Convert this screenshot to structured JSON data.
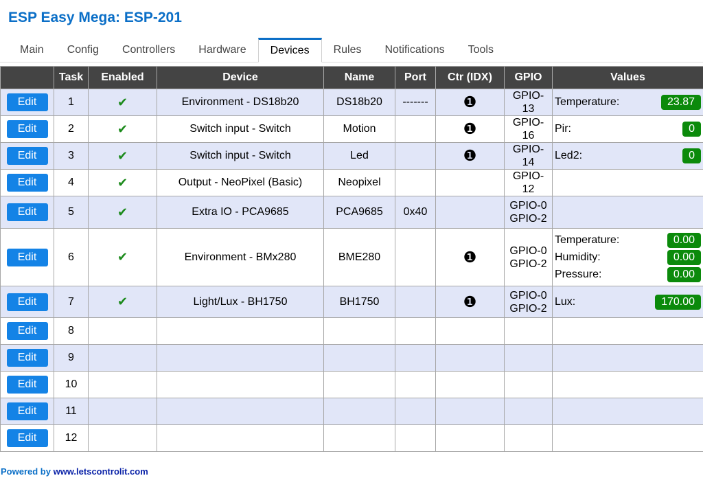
{
  "app": {
    "title": "ESP Easy Mega: ESP-201"
  },
  "tabs": [
    {
      "label": "Main"
    },
    {
      "label": "Config"
    },
    {
      "label": "Controllers"
    },
    {
      "label": "Hardware"
    },
    {
      "label": "Devices"
    },
    {
      "label": "Rules"
    },
    {
      "label": "Notifications"
    },
    {
      "label": "Tools"
    }
  ],
  "active_tab": "Devices",
  "table": {
    "headers": [
      "",
      "Task",
      "Enabled",
      "Device",
      "Name",
      "Port",
      "Ctr (IDX)",
      "GPIO",
      "Values"
    ],
    "edit_label": "Edit",
    "rows": [
      {
        "task": "1",
        "enabled": "✔",
        "device": "Environment - DS18b20",
        "name": "DS18b20",
        "port": "-------",
        "ctr": "❶",
        "gpio": [
          "GPIO-13"
        ],
        "values": [
          {
            "label": "Temperature:",
            "value": "23.87"
          }
        ]
      },
      {
        "task": "2",
        "enabled": "✔",
        "device": "Switch input - Switch",
        "name": "Motion",
        "port": "",
        "ctr": "❶",
        "gpio": [
          "GPIO-16"
        ],
        "values": [
          {
            "label": "Pir:",
            "value": "0"
          }
        ]
      },
      {
        "task": "3",
        "enabled": "✔",
        "device": "Switch input - Switch",
        "name": "Led",
        "port": "",
        "ctr": "❶",
        "gpio": [
          "GPIO-14"
        ],
        "values": [
          {
            "label": "Led2:",
            "value": "0"
          }
        ]
      },
      {
        "task": "4",
        "enabled": "✔",
        "device": "Output - NeoPixel (Basic)",
        "name": "Neopixel",
        "port": "",
        "ctr": "",
        "gpio": [
          "GPIO-12"
        ],
        "values": []
      },
      {
        "task": "5",
        "enabled": "✔",
        "device": "Extra IO - PCA9685",
        "name": "PCA9685",
        "port": "0x40",
        "ctr": "",
        "gpio": [
          "GPIO-0",
          "GPIO-2"
        ],
        "values": []
      },
      {
        "task": "6",
        "enabled": "✔",
        "device": "Environment - BMx280",
        "name": "BME280",
        "port": "",
        "ctr": "❶",
        "gpio": [
          "GPIO-0",
          "GPIO-2"
        ],
        "values": [
          {
            "label": "Temperature:",
            "value": "0.00"
          },
          {
            "label": "Humidity:",
            "value": "0.00"
          },
          {
            "label": "Pressure:",
            "value": "0.00"
          }
        ]
      },
      {
        "task": "7",
        "enabled": "✔",
        "device": "Light/Lux - BH1750",
        "name": "BH1750",
        "port": "",
        "ctr": "❶",
        "gpio": [
          "GPIO-0",
          "GPIO-2"
        ],
        "values": [
          {
            "label": "Lux:",
            "value": "170.00"
          }
        ]
      },
      {
        "task": "8",
        "enabled": "",
        "device": "",
        "name": "",
        "port": "",
        "ctr": "",
        "gpio": [],
        "values": []
      },
      {
        "task": "9",
        "enabled": "",
        "device": "",
        "name": "",
        "port": "",
        "ctr": "",
        "gpio": [],
        "values": []
      },
      {
        "task": "10",
        "enabled": "",
        "device": "",
        "name": "",
        "port": "",
        "ctr": "",
        "gpio": [],
        "values": []
      },
      {
        "task": "11",
        "enabled": "",
        "device": "",
        "name": "",
        "port": "",
        "ctr": "",
        "gpio": [],
        "values": []
      },
      {
        "task": "12",
        "enabled": "",
        "device": "",
        "name": "",
        "port": "",
        "ctr": "",
        "gpio": [],
        "values": []
      }
    ]
  },
  "footer": {
    "prefix": "Powered by ",
    "link": "www.letscontrolit.com"
  },
  "colors": {
    "accent": "#0b6fc7",
    "header_bg": "#444444",
    "alt_row": "#e1e6f8",
    "badge": "#0b8a0b",
    "button": "#1483e6"
  }
}
